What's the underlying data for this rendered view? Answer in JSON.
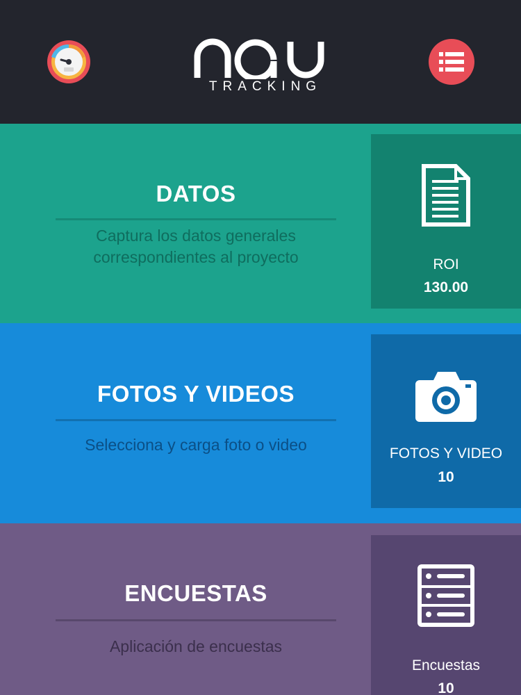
{
  "header": {
    "logo_word": "nau",
    "logo_sub": "TRACKING",
    "left_icon": "speedometer-icon",
    "right_icon": "list-menu-icon",
    "menu_color": "#e84d57"
  },
  "sections": [
    {
      "title": "DATOS",
      "description": "Captura los datos generales correspondientes al proyecto",
      "icon": "document-icon",
      "card_label": "ROI",
      "card_value": "130.00",
      "color": "#1ca38d",
      "card_color": "#13826f"
    },
    {
      "title": "FOTOS Y VIDEOS",
      "description": "Selecciona y carga foto o video",
      "icon": "camera-icon",
      "card_label": "FOTOS Y VIDEO",
      "card_value": "10",
      "color": "#178bda",
      "card_color": "#0f6aa8"
    },
    {
      "title": "ENCUESTAS",
      "description": "Aplicación de encuestas",
      "icon": "server-list-icon",
      "card_label": "Encuestas",
      "card_value": "10",
      "color": "#6f5b86",
      "card_color": "#564670"
    }
  ]
}
